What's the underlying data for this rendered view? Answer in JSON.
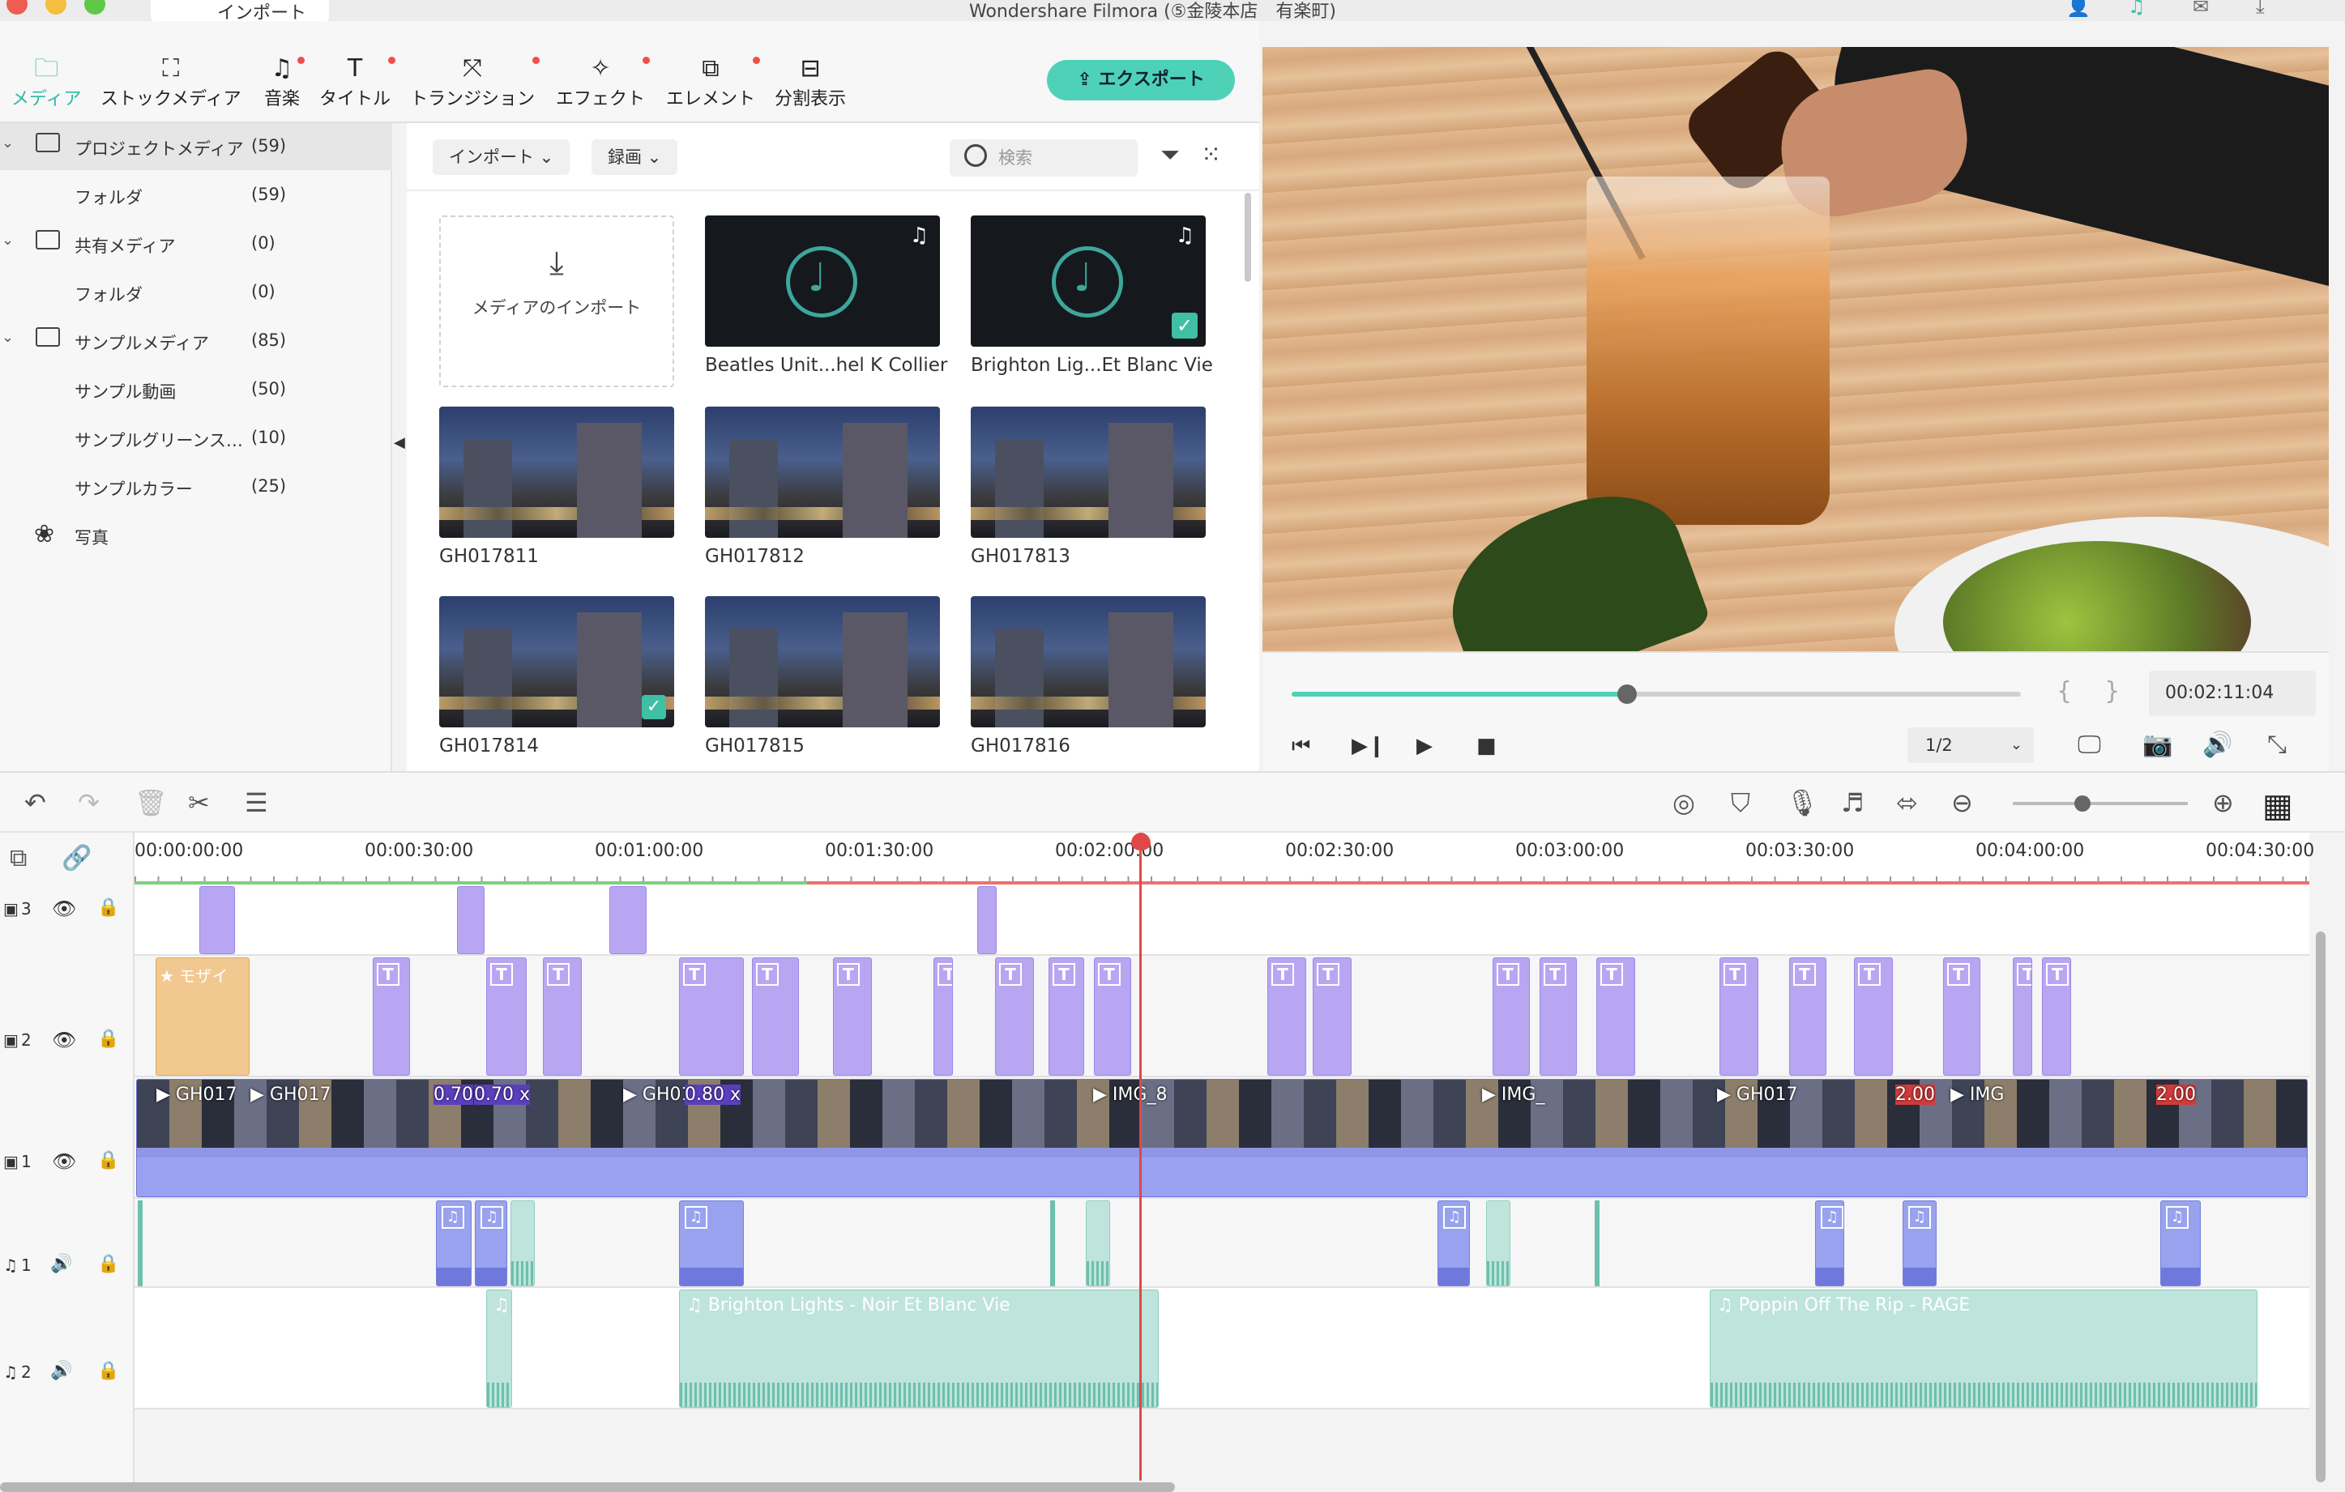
{
  "window": {
    "title": "Wondershare Filmora (⑤金陵本店　有楽町)",
    "import_tab": "インポート",
    "colors": {
      "accent": "#4ed2b7",
      "playhead": "#e04848",
      "effect_clip": "#b9a6f2",
      "video_clip": "#8f96e6",
      "music_clip": "#bfe4db"
    }
  },
  "toolbar": {
    "tabs": [
      {
        "label": "メディア",
        "icon": "folder-icon"
      },
      {
        "label": "ストックメディア",
        "icon": "stock-media-icon"
      },
      {
        "label": "音楽",
        "icon": "music-icon"
      },
      {
        "label": "タイトル",
        "icon": "title-icon"
      },
      {
        "label": "トランジション",
        "icon": "transition-icon"
      },
      {
        "label": "エフェクト",
        "icon": "effect-icon"
      },
      {
        "label": "エレメント",
        "icon": "element-icon"
      },
      {
        "label": "分割表示",
        "icon": "split-screen-icon"
      }
    ],
    "export_label": "エクスポート"
  },
  "library": {
    "items": [
      {
        "label": "プロジェクトメディア",
        "count": "(59)"
      },
      {
        "label": "フォルダ",
        "count": "(59)"
      },
      {
        "label": "共有メディア",
        "count": "(0)"
      },
      {
        "label": "フォルダ",
        "count": "(0)"
      },
      {
        "label": "サンプルメディア",
        "count": "(85)"
      },
      {
        "label": "サンプル動画",
        "count": "(50)"
      },
      {
        "label": "サンプルグリーンス…",
        "count": "(10)"
      },
      {
        "label": "サンプルカラー",
        "count": "(25)"
      },
      {
        "label": "写真",
        "count": ""
      }
    ]
  },
  "media": {
    "import_dropdown": "インポート",
    "record_dropdown": "録画",
    "search_placeholder": "検索",
    "import_card_label": "メディアのインポート",
    "items": [
      {
        "name": "Beatles Unit...hel K Collier"
      },
      {
        "name": "Brighton Lig...Et Blanc Vie"
      },
      {
        "name": "GH017811"
      },
      {
        "name": "GH017812"
      },
      {
        "name": "GH017813"
      },
      {
        "name": "GH017814"
      },
      {
        "name": "GH017815"
      },
      {
        "name": "GH017816"
      }
    ]
  },
  "player": {
    "timecode": "00:02:11:04",
    "ratio": "1/2",
    "progress": 0.46,
    "in_mark": "{",
    "out_mark": "}"
  },
  "timeline": {
    "ruler": [
      "00:00:00:00",
      "00:00:30:00",
      "00:01:00:00",
      "00:01:30:00",
      "00:02:00:00",
      "00:02:30:00",
      "00:03:00:00",
      "00:03:30:00",
      "00:04:00:00",
      "00:04:30:00"
    ],
    "zoom_level": 0.4,
    "tracks": {
      "v3": "3",
      "v2": "2",
      "v1": "1",
      "a1": "1",
      "a2": "2"
    },
    "sticker_label": "モザイ",
    "video_labels": [
      "GH017",
      "GH017",
      "0.70",
      "0.70 x",
      "GH01",
      "0.80 x",
      "IMG_8",
      "IMG_",
      "GH017",
      "2.00",
      "IMG",
      "2.00"
    ],
    "music_clips": [
      "Brighton Lights - Noir Et Blanc Vie",
      "Poppin Off The Rip - RAGE"
    ]
  }
}
